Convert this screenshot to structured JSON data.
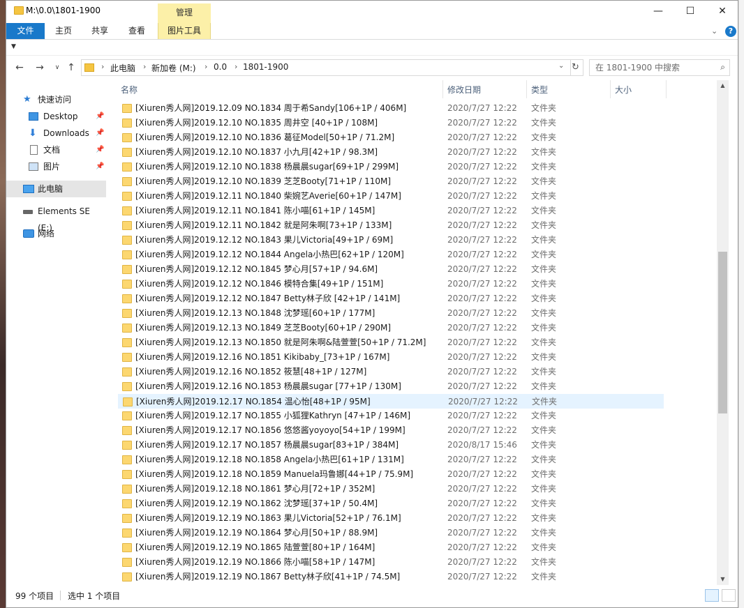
{
  "window": {
    "title": "M:\\0.0\\1801-1900",
    "context_tab": "管理",
    "minimize": "—",
    "maximize": "☐",
    "close": "✕"
  },
  "ribbon": {
    "tabs": [
      "文件",
      "主页",
      "共享",
      "查看",
      "图片工具"
    ],
    "help": "?"
  },
  "address": {
    "crumbs": [
      "此电脑",
      "新加卷 (M:)",
      "0.0",
      "1801-1900"
    ],
    "search_placeholder": "在 1801-1900 中搜索"
  },
  "sidebar": {
    "items": [
      {
        "label": "快速访问",
        "icon": "star-icon"
      },
      {
        "label": "Desktop",
        "icon": "desktop-icon",
        "pinned": true
      },
      {
        "label": "Downloads",
        "icon": "download-icon",
        "pinned": true
      },
      {
        "label": "文档",
        "icon": "document-icon",
        "pinned": true
      },
      {
        "label": "图片",
        "icon": "picture-icon",
        "pinned": true
      },
      {
        "label": "此电脑",
        "icon": "computer-icon",
        "selected": true
      },
      {
        "label": "Elements SE (E:)",
        "icon": "drive-icon"
      },
      {
        "label": "网络",
        "icon": "network-icon"
      }
    ]
  },
  "columns": {
    "name": "名称",
    "date": "修改日期",
    "type": "类型",
    "size": "大小"
  },
  "files": [
    {
      "name": "[Xiuren秀人网]2019.12.09 NO.1834 周于希Sandy[106+1P / 406M]",
      "date": "2020/7/27 12:22",
      "type": "文件夹"
    },
    {
      "name": "[Xiuren秀人网]2019.12.10 NO.1835 周井空 [40+1P / 108M]",
      "date": "2020/7/27 12:22",
      "type": "文件夹"
    },
    {
      "name": "[Xiuren秀人网]2019.12.10 NO.1836 葛征Model[50+1P / 71.2M]",
      "date": "2020/7/27 12:22",
      "type": "文件夹"
    },
    {
      "name": "[Xiuren秀人网]2019.12.10 NO.1837 小九月[42+1P / 98.3M]",
      "date": "2020/7/27 12:22",
      "type": "文件夹"
    },
    {
      "name": "[Xiuren秀人网]2019.12.10 NO.1838 杨晨晨sugar[69+1P / 299M]",
      "date": "2020/7/27 12:22",
      "type": "文件夹"
    },
    {
      "name": "[Xiuren秀人网]2019.12.10 NO.1839 芝芝Booty[71+1P / 110M]",
      "date": "2020/7/27 12:22",
      "type": "文件夹"
    },
    {
      "name": "[Xiuren秀人网]2019.12.11 NO.1840 柴婉艺Averie[60+1P / 147M]",
      "date": "2020/7/27 12:22",
      "type": "文件夹"
    },
    {
      "name": "[Xiuren秀人网]2019.12.11 NO.1841 陈小喵[61+1P / 145M]",
      "date": "2020/7/27 12:22",
      "type": "文件夹"
    },
    {
      "name": "[Xiuren秀人网]2019.12.11 NO.1842 就是阿朱啊[73+1P / 133M]",
      "date": "2020/7/27 12:22",
      "type": "文件夹"
    },
    {
      "name": "[Xiuren秀人网]2019.12.12 NO.1843 果儿Victoria[49+1P / 69M]",
      "date": "2020/7/27 12:22",
      "type": "文件夹"
    },
    {
      "name": "[Xiuren秀人网]2019.12.12 NO.1844 Angela小热巴[62+1P / 120M]",
      "date": "2020/7/27 12:22",
      "type": "文件夹"
    },
    {
      "name": "[Xiuren秀人网]2019.12.12 NO.1845 梦心月[57+1P / 94.6M]",
      "date": "2020/7/27 12:22",
      "type": "文件夹"
    },
    {
      "name": "[Xiuren秀人网]2019.12.12 NO.1846 模特合集[49+1P / 151M]",
      "date": "2020/7/27 12:22",
      "type": "文件夹"
    },
    {
      "name": "[Xiuren秀人网]2019.12.12 NO.1847 Betty林子欣 [42+1P / 141M]",
      "date": "2020/7/27 12:22",
      "type": "文件夹"
    },
    {
      "name": "[Xiuren秀人网]2019.12.13 NO.1848 沈梦瑶[60+1P / 177M]",
      "date": "2020/7/27 12:22",
      "type": "文件夹"
    },
    {
      "name": "[Xiuren秀人网]2019.12.13 NO.1849 芝芝Booty[60+1P / 290M]",
      "date": "2020/7/27 12:22",
      "type": "文件夹"
    },
    {
      "name": "[Xiuren秀人网]2019.12.13 NO.1850 就是阿朱啊&陆萱萱[50+1P / 71.2M]",
      "date": "2020/7/27 12:22",
      "type": "文件夹"
    },
    {
      "name": "[Xiuren秀人网]2019.12.16 NO.1851 Kikibaby_[73+1P / 167M]",
      "date": "2020/7/27 12:22",
      "type": "文件夹"
    },
    {
      "name": "[Xiuren秀人网]2019.12.16 NO.1852 筱慧[48+1P / 127M]",
      "date": "2020/7/27 12:22",
      "type": "文件夹"
    },
    {
      "name": "[Xiuren秀人网]2019.12.16 NO.1853 杨晨晨sugar [77+1P / 130M]",
      "date": "2020/7/27 12:22",
      "type": "文件夹"
    },
    {
      "name": "[Xiuren秀人网]2019.12.17 NO.1854 温心怡[48+1P / 95M]",
      "date": "2020/7/27 12:22",
      "type": "文件夹",
      "selected": true
    },
    {
      "name": "[Xiuren秀人网]2019.12.17 NO.1855 小狐狸Kathryn [47+1P / 146M]",
      "date": "2020/7/27 12:22",
      "type": "文件夹"
    },
    {
      "name": "[Xiuren秀人网]2019.12.17 NO.1856 悠悠酱yoyoyo[54+1P / 199M]",
      "date": "2020/7/27 12:22",
      "type": "文件夹"
    },
    {
      "name": "[Xiuren秀人网]2019.12.17 NO.1857 杨晨晨sugar[83+1P / 384M]",
      "date": "2020/8/17 15:46",
      "type": "文件夹"
    },
    {
      "name": "[Xiuren秀人网]2019.12.18 NO.1858 Angela小热巴[61+1P / 131M]",
      "date": "2020/7/27 12:22",
      "type": "文件夹"
    },
    {
      "name": "[Xiuren秀人网]2019.12.18 NO.1859 Manuela玛鲁娜[44+1P / 75.9M]",
      "date": "2020/7/27 12:22",
      "type": "文件夹"
    },
    {
      "name": "[Xiuren秀人网]2019.12.18 NO.1861 梦心月[72+1P / 352M]",
      "date": "2020/7/27 12:22",
      "type": "文件夹"
    },
    {
      "name": "[Xiuren秀人网]2019.12.19 NO.1862 沈梦瑶[37+1P / 50.4M]",
      "date": "2020/7/27 12:22",
      "type": "文件夹"
    },
    {
      "name": "[Xiuren秀人网]2019.12.19 NO.1863 果儿Victoria[52+1P / 76.1M]",
      "date": "2020/7/27 12:22",
      "type": "文件夹"
    },
    {
      "name": "[Xiuren秀人网]2019.12.19 NO.1864 梦心月[50+1P / 88.9M]",
      "date": "2020/7/27 12:22",
      "type": "文件夹"
    },
    {
      "name": "[Xiuren秀人网]2019.12.19 NO.1865 陆萱萱[80+1P / 164M]",
      "date": "2020/7/27 12:22",
      "type": "文件夹"
    },
    {
      "name": "[Xiuren秀人网]2019.12.19 NO.1866 陈小喵[58+1P / 147M]",
      "date": "2020/7/27 12:22",
      "type": "文件夹"
    },
    {
      "name": "[Xiuren秀人网]2019.12.19 NO.1867 Betty林子欣[41+1P / 74.5M]",
      "date": "2020/7/27 12:22",
      "type": "文件夹"
    }
  ],
  "status": {
    "count": "99 个项目",
    "selection": "选中 1 个项目"
  }
}
